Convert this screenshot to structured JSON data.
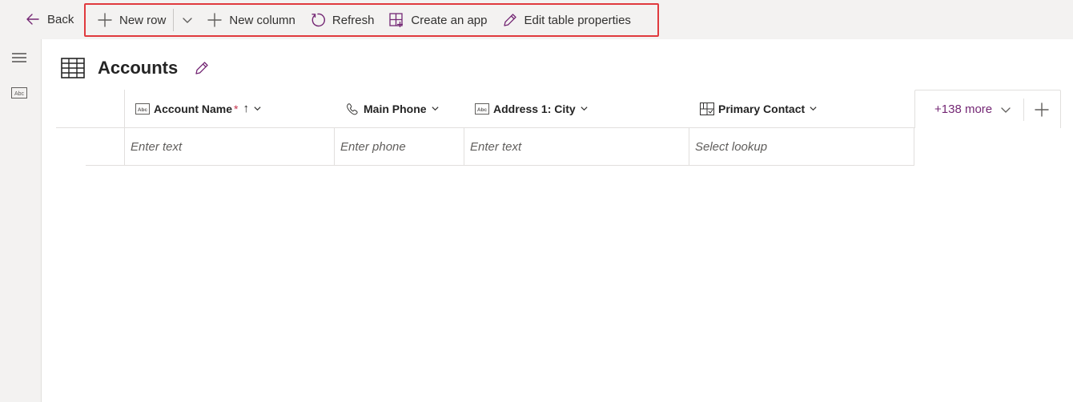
{
  "toolbar": {
    "back_label": "Back",
    "new_row_label": "New row",
    "new_column_label": "New column",
    "refresh_label": "Refresh",
    "create_app_label": "Create an app",
    "edit_table_label": "Edit table properties",
    "highlight_color": "#e03a3e"
  },
  "page": {
    "title": "Accounts",
    "icon": "table-grid-icon"
  },
  "columns": [
    {
      "label": "Account Name",
      "required_mark": "*",
      "sort_indicator": "↑",
      "icon": "text-field-icon"
    },
    {
      "label": "Main Phone",
      "icon": "phone-icon"
    },
    {
      "label": "Address 1: City",
      "icon": "text-field-icon"
    },
    {
      "label": "Primary Contact",
      "icon": "lookup-icon"
    }
  ],
  "more_columns_label": "+138 more",
  "new_row_placeholders": [
    "Enter text",
    "Enter phone",
    "Enter text",
    "Select lookup"
  ],
  "colors": {
    "accent": "#742774",
    "command_bar_bg": "#f3f2f1"
  }
}
